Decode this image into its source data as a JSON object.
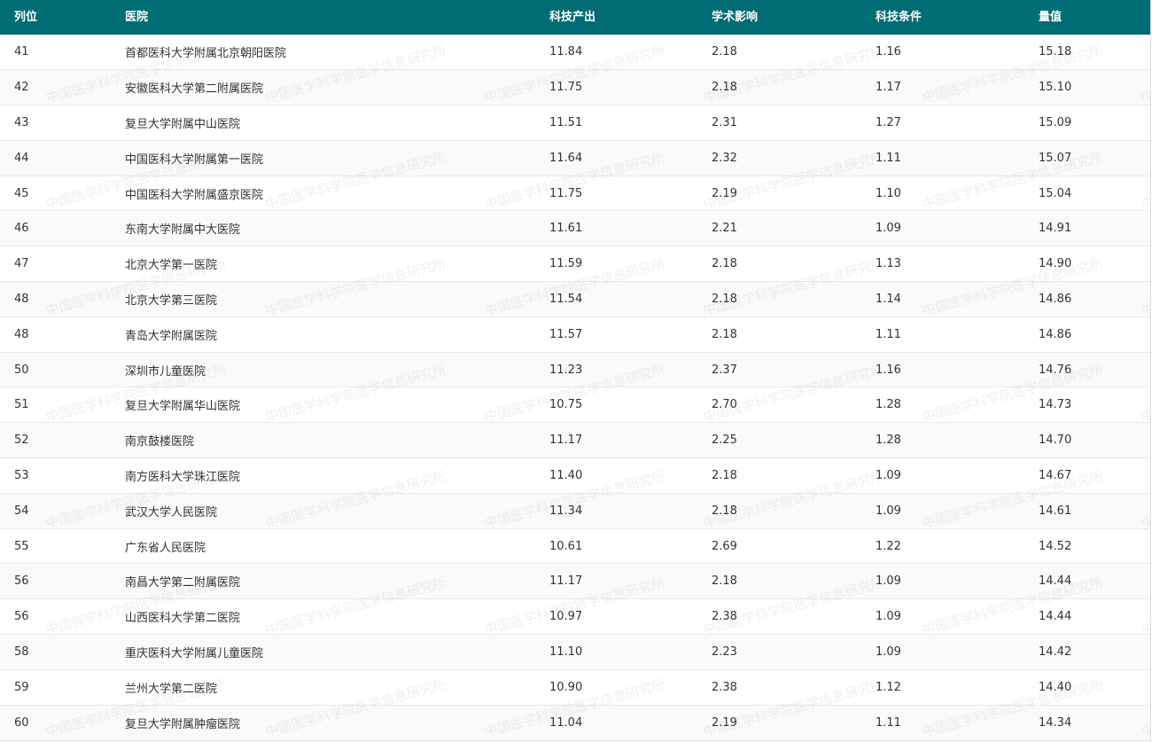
{
  "colors": {
    "header_bg": "#006c74",
    "header_text": "#ffffff",
    "row_alt_bg": "#fafafa",
    "text": "#333333"
  },
  "table": {
    "columns": [
      "列位",
      "医院",
      "科技产出",
      "学术影响",
      "科技条件",
      "量值"
    ],
    "rows": [
      [
        "41",
        "首都医科大学附属北京朝阳医院",
        "11.84",
        "2.18",
        "1.16",
        "15.18"
      ],
      [
        "42",
        "安徽医科大学第二附属医院",
        "11.75",
        "2.18",
        "1.17",
        "15.10"
      ],
      [
        "43",
        "复旦大学附属中山医院",
        "11.51",
        "2.31",
        "1.27",
        "15.09"
      ],
      [
        "44",
        "中国医科大学附属第一医院",
        "11.64",
        "2.32",
        "1.11",
        "15.07"
      ],
      [
        "45",
        "中国医科大学附属盛京医院",
        "11.75",
        "2.19",
        "1.10",
        "15.04"
      ],
      [
        "46",
        "东南大学附属中大医院",
        "11.61",
        "2.21",
        "1.09",
        "14.91"
      ],
      [
        "47",
        "北京大学第一医院",
        "11.59",
        "2.18",
        "1.13",
        "14.90"
      ],
      [
        "48",
        "北京大学第三医院",
        "11.54",
        "2.18",
        "1.14",
        "14.86"
      ],
      [
        "48",
        "青岛大学附属医院",
        "11.57",
        "2.18",
        "1.11",
        "14.86"
      ],
      [
        "50",
        "深圳市儿童医院",
        "11.23",
        "2.37",
        "1.16",
        "14.76"
      ],
      [
        "51",
        "复旦大学附属华山医院",
        "10.75",
        "2.70",
        "1.28",
        "14.73"
      ],
      [
        "52",
        "南京鼓楼医院",
        "11.17",
        "2.25",
        "1.28",
        "14.70"
      ],
      [
        "53",
        "南方医科大学珠江医院",
        "11.40",
        "2.18",
        "1.09",
        "14.67"
      ],
      [
        "54",
        "武汉大学人民医院",
        "11.34",
        "2.18",
        "1.09",
        "14.61"
      ],
      [
        "55",
        "广东省人民医院",
        "10.61",
        "2.69",
        "1.22",
        "14.52"
      ],
      [
        "56",
        "南昌大学第二附属医院",
        "11.17",
        "2.18",
        "1.09",
        "14.44"
      ],
      [
        "56",
        "山西医科大学第二医院",
        "10.97",
        "2.38",
        "1.09",
        "14.44"
      ],
      [
        "58",
        "重庆医科大学附属儿童医院",
        "11.10",
        "2.23",
        "1.09",
        "14.42"
      ],
      [
        "59",
        "兰州大学第二医院",
        "10.90",
        "2.38",
        "1.12",
        "14.40"
      ],
      [
        "60",
        "复旦大学附属肿瘤医院",
        "11.04",
        "2.19",
        "1.11",
        "14.34"
      ]
    ]
  },
  "watermark": {
    "text": "中国医学科学院医学信息研究所"
  }
}
